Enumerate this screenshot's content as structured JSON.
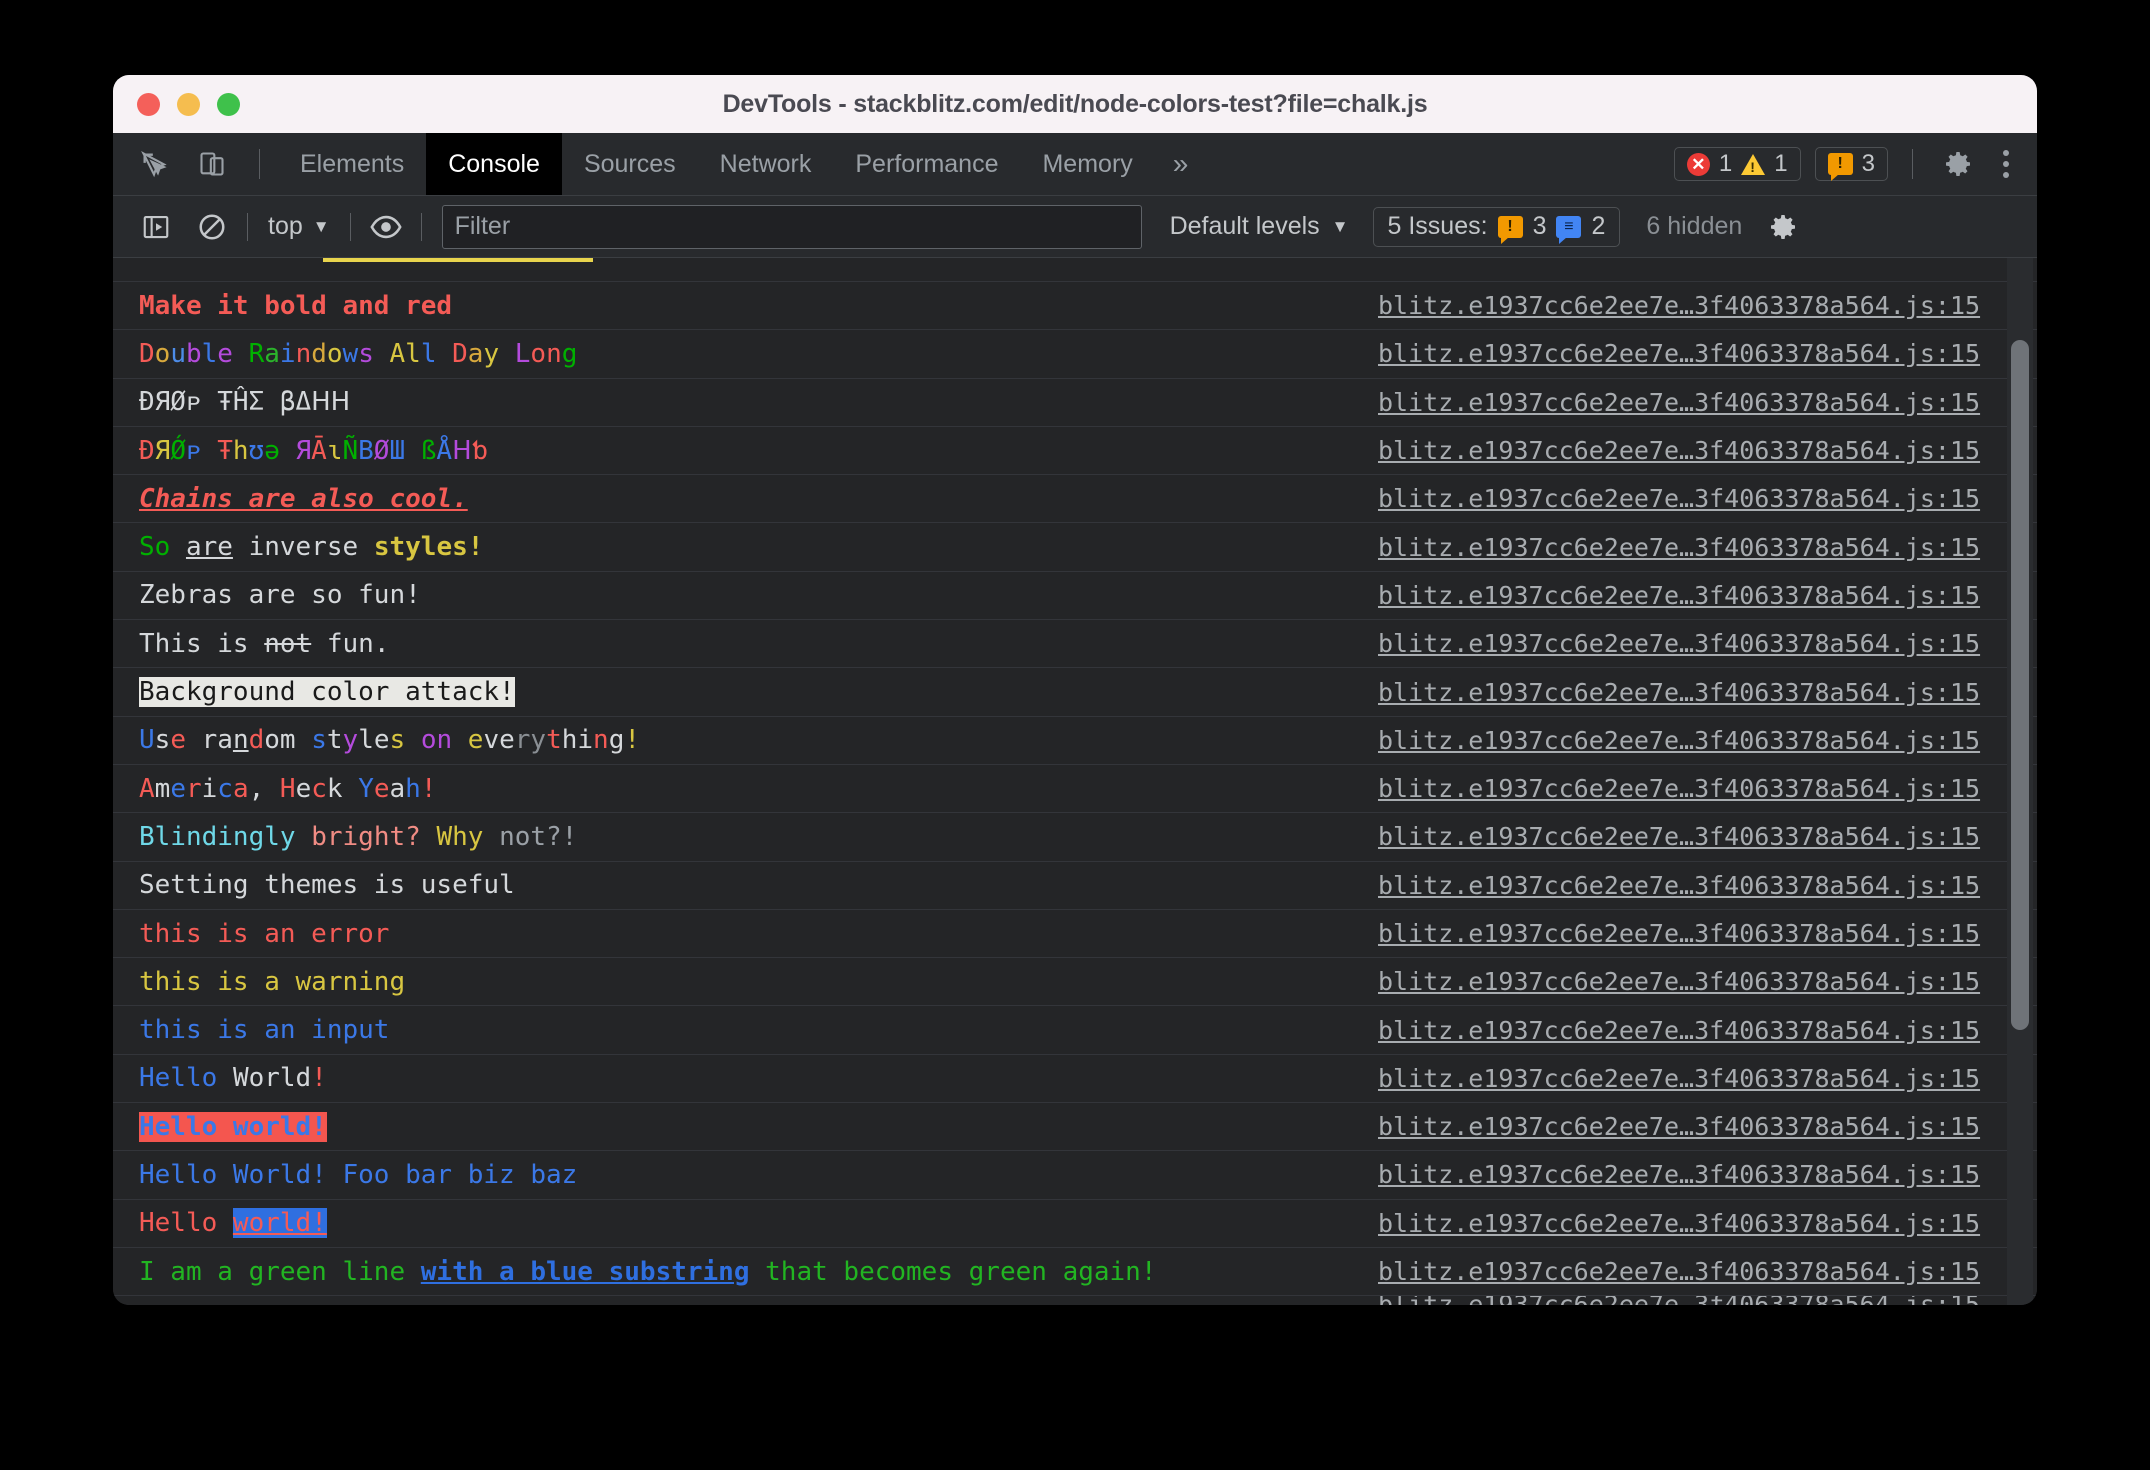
{
  "window": {
    "title": "DevTools - stackblitz.com/edit/node-colors-test?file=chalk.js",
    "traffic_lights": [
      "close",
      "minimize",
      "maximize"
    ]
  },
  "tabbar": {
    "inspect_icon": "inspect-element-icon",
    "device_icon": "device-toolbar-icon",
    "tabs": [
      {
        "label": "Elements",
        "active": false
      },
      {
        "label": "Console",
        "active": true
      },
      {
        "label": "Sources",
        "active": false
      },
      {
        "label": "Network",
        "active": false
      },
      {
        "label": "Performance",
        "active": false
      },
      {
        "label": "Memory",
        "active": false
      }
    ],
    "more_tabs_label": "»",
    "error_count": "1",
    "warning_count": "1",
    "issue_count": "3",
    "settings_icon": "gear-icon",
    "menu_icon": "kebab-menu-icon"
  },
  "console_toolbar": {
    "sidebar_icon": "console-sidebar-icon",
    "clear_icon": "clear-console-icon",
    "context": "top",
    "context_caret": "▼",
    "eye_icon": "live-expression-icon",
    "filter_placeholder": "Filter",
    "filter_value": "",
    "levels_label": "Default levels",
    "levels_caret": "▼",
    "issues_label": "5 Issues:",
    "issues_warning_count": "3",
    "issues_info_count": "2",
    "hidden_label": "6 hidden",
    "settings_icon": "console-settings-gear-icon"
  },
  "colors": {
    "red": "#f45b56",
    "bright_red": "#ff5f57",
    "green": "#00b000",
    "bright_green": "#3ec93e",
    "blue": "#3b78e7",
    "bright_blue": "#2f6fe0",
    "yellow": "#d8c641",
    "magenta": "#b44bdc",
    "cyan": "#6fd8e8",
    "white": "#d5d8db",
    "grey": "#9aa0a6",
    "bg_light": "#e8e8e4",
    "bg_dark": "#1a1a1a",
    "link": "#a8acb0"
  },
  "source_link": "blitz.e1937cc6e2ee7e…3f4063378a564.js:15",
  "messages": [
    {
      "id": "msg-partial-top",
      "partial": true,
      "segments": []
    },
    {
      "id": "msg-bold-red",
      "segments": [
        {
          "t": "Make it bold and red",
          "c": "#f45b56",
          "bold": true
        }
      ]
    },
    {
      "id": "msg-double-rainbow",
      "segments": [
        {
          "t": "D",
          "c": "#f45b56"
        },
        {
          "t": "o",
          "c": "#d8a93d"
        },
        {
          "t": "u",
          "c": "#4d8ce8"
        },
        {
          "t": "b",
          "c": "#b44bdc"
        },
        {
          "t": "l",
          "c": "#3b78e7"
        },
        {
          "t": "e",
          "c": "#b44bdc"
        },
        {
          "t": " ",
          "c": "#d5d8db"
        },
        {
          "t": "R",
          "c": "#00b000"
        },
        {
          "t": "a",
          "c": "#2bb32b"
        },
        {
          "t": "i",
          "c": "#3b78e7"
        },
        {
          "t": "n",
          "c": "#f45b56"
        },
        {
          "t": "d",
          "c": "#d8a93d"
        },
        {
          "t": "o",
          "c": "#d8c641"
        },
        {
          "t": "w",
          "c": "#3b78e7"
        },
        {
          "t": "s",
          "c": "#b44bdc"
        },
        {
          "t": " ",
          "c": "#d5d8db"
        },
        {
          "t": "A",
          "c": "#d8c641"
        },
        {
          "t": "l",
          "c": "#d8c641"
        },
        {
          "t": "l",
          "c": "#3b78e7"
        },
        {
          "t": " ",
          "c": "#d5d8db"
        },
        {
          "t": "D",
          "c": "#f45b56"
        },
        {
          "t": "a",
          "c": "#d8a93d"
        },
        {
          "t": "y",
          "c": "#d8c641"
        },
        {
          "t": " ",
          "c": "#d5d8db"
        },
        {
          "t": "L",
          "c": "#b44bdc"
        },
        {
          "t": "o",
          "c": "#f45b56"
        },
        {
          "t": "n",
          "c": "#f45b56"
        },
        {
          "t": "g",
          "c": "#00b000"
        }
      ]
    },
    {
      "id": "msg-drop-the-bass",
      "segments": [
        {
          "t": "ÐЯØᴘ ŦĤΣ βΔᕼᕼ",
          "c": "#d5d8db"
        }
      ]
    },
    {
      "id": "msg-drop-the-rainbow-bass",
      "segments": [
        {
          "t": "Ð",
          "c": "#f45b56"
        },
        {
          "t": "Я",
          "c": "#d8c641"
        },
        {
          "t": "Ǿ",
          "c": "#00b000"
        },
        {
          "t": "ᴘ",
          "c": "#3b78e7"
        },
        {
          "t": " ",
          "c": "#d5d8db"
        },
        {
          "t": "Ŧ",
          "c": "#f45b56"
        },
        {
          "t": "h",
          "c": "#d8c641"
        },
        {
          "t": "ʊ",
          "c": "#3b78e7"
        },
        {
          "t": "ə",
          "c": "#00b000"
        },
        {
          "t": " ",
          "c": "#d5d8db"
        },
        {
          "t": "Я",
          "c": "#b44bdc"
        },
        {
          "t": "Ā",
          "c": "#f45b56"
        },
        {
          "t": "ɩ",
          "c": "#d8c641"
        },
        {
          "t": "Ñ",
          "c": "#00b000"
        },
        {
          "t": "B",
          "c": "#3b78e7"
        },
        {
          "t": "Ø",
          "c": "#b44bdc"
        },
        {
          "t": "Ш",
          "c": "#3b78e7"
        },
        {
          "t": " ",
          "c": "#d5d8db"
        },
        {
          "t": "ß",
          "c": "#00b000"
        },
        {
          "t": "Å",
          "c": "#3b78e7"
        },
        {
          "t": "ᕼ",
          "c": "#b44bdc"
        },
        {
          "t": "ƅ",
          "c": "#f45b56"
        }
      ]
    },
    {
      "id": "msg-chains",
      "segments": [
        {
          "t": "Chains are also cool.",
          "c": "#f45b56",
          "bold": true,
          "italic": true,
          "underline": true
        }
      ]
    },
    {
      "id": "msg-inverse-styles",
      "segments": [
        {
          "t": "So",
          "c": "#00b000"
        },
        {
          "t": " ",
          "c": "#d5d8db"
        },
        {
          "t": "are",
          "c": "#d5d8db",
          "underline": true
        },
        {
          "t": " inverse ",
          "c": "#d5d8db"
        },
        {
          "t": "styles!",
          "c": "#d8c641",
          "bold": true
        }
      ]
    },
    {
      "id": "msg-zebras",
      "segments": [
        {
          "t": "Zebras are so fun!",
          "c": "#d5d8db"
        }
      ]
    },
    {
      "id": "msg-not-fun",
      "segments": [
        {
          "t": "This is ",
          "c": "#d5d8db"
        },
        {
          "t": "not",
          "c": "#d5d8db",
          "strike": true
        },
        {
          "t": " fun.",
          "c": "#d5d8db"
        }
      ]
    },
    {
      "id": "msg-background-attack",
      "segments": [
        {
          "t": "Background color attack!",
          "c": "#1a1a1a",
          "bg": "#e8e8e4"
        }
      ]
    },
    {
      "id": "msg-random-styles",
      "segments": [
        {
          "t": "U",
          "c": "#3b78e7"
        },
        {
          "t": "s",
          "c": "#d5d8db"
        },
        {
          "t": "e",
          "c": "#f45b56"
        },
        {
          "t": " ",
          "c": "#d5d8db"
        },
        {
          "t": "r",
          "c": "#d5d8db"
        },
        {
          "t": "a",
          "c": "#d5d8db"
        },
        {
          "t": "n",
          "c": "#d5d8db",
          "underline": true
        },
        {
          "t": "d",
          "c": "#f45b56"
        },
        {
          "t": "o",
          "c": "#d5d8db"
        },
        {
          "t": "m",
          "c": "#d5d8db"
        },
        {
          "t": " ",
          "c": "#d5d8db"
        },
        {
          "t": "s",
          "c": "#3b78e7"
        },
        {
          "t": "t",
          "c": "#d5d8db"
        },
        {
          "t": "y",
          "c": "#b44bdc"
        },
        {
          "t": "l",
          "c": "#d5d8db"
        },
        {
          "t": "e",
          "c": "#d5d8db"
        },
        {
          "t": "s",
          "c": "#d8c641"
        },
        {
          "t": " ",
          "c": "#d5d8db"
        },
        {
          "t": "o",
          "c": "#b44bdc"
        },
        {
          "t": "n",
          "c": "#b44bdc"
        },
        {
          "t": " ",
          "c": "#d5d8db"
        },
        {
          "t": "e",
          "c": "#d8c641"
        },
        {
          "t": "v",
          "c": "#d5d8db"
        },
        {
          "t": "e",
          "c": "#d5d8db"
        },
        {
          "t": "r",
          "c": "#8a8f94"
        },
        {
          "t": "y",
          "c": "#8a8f94"
        },
        {
          "t": "t",
          "c": "#f45b56"
        },
        {
          "t": "h",
          "c": "#d5d8db"
        },
        {
          "t": "i",
          "c": "#d5d8db"
        },
        {
          "t": "n",
          "c": "#f45b56"
        },
        {
          "t": "g",
          "c": "#d5d8db"
        },
        {
          "t": "!",
          "c": "#d8c641"
        }
      ]
    },
    {
      "id": "msg-america",
      "segments": [
        {
          "t": "A",
          "c": "#f45b56"
        },
        {
          "t": "m",
          "c": "#d5d8db"
        },
        {
          "t": "e",
          "c": "#3b78e7"
        },
        {
          "t": "r",
          "c": "#f45b56"
        },
        {
          "t": "i",
          "c": "#d5d8db"
        },
        {
          "t": "c",
          "c": "#3b78e7"
        },
        {
          "t": "a",
          "c": "#f45b56"
        },
        {
          "t": ", ",
          "c": "#d5d8db"
        },
        {
          "t": "H",
          "c": "#f45b56"
        },
        {
          "t": "e",
          "c": "#d5d8db"
        },
        {
          "t": "c",
          "c": "#f45b56"
        },
        {
          "t": "k",
          "c": "#d5d8db"
        },
        {
          "t": " ",
          "c": "#d5d8db"
        },
        {
          "t": "Y",
          "c": "#3b78e7"
        },
        {
          "t": "e",
          "c": "#f45b56"
        },
        {
          "t": "a",
          "c": "#d5d8db"
        },
        {
          "t": "h",
          "c": "#3b78e7"
        },
        {
          "t": "!",
          "c": "#f45b56"
        }
      ]
    },
    {
      "id": "msg-blindingly-bright",
      "segments": [
        {
          "t": "Blindingly",
          "c": "#6fd8e8"
        },
        {
          "t": " ",
          "c": "#d5d8db"
        },
        {
          "t": "bright?",
          "c": "#f08c84"
        },
        {
          "t": " ",
          "c": "#d5d8db"
        },
        {
          "t": "Why",
          "c": "#d8c641"
        },
        {
          "t": " ",
          "c": "#d5d8db"
        },
        {
          "t": "not?!",
          "c": "#9aa0a6"
        }
      ]
    },
    {
      "id": "msg-themes",
      "segments": [
        {
          "t": "Setting themes is useful",
          "c": "#d5d8db"
        }
      ]
    },
    {
      "id": "msg-error",
      "segments": [
        {
          "t": "this is an error",
          "c": "#f45b56"
        }
      ]
    },
    {
      "id": "msg-warning",
      "segments": [
        {
          "t": "this is a warning",
          "c": "#d8c641"
        }
      ]
    },
    {
      "id": "msg-input",
      "segments": [
        {
          "t": "this is an input",
          "c": "#3b78e7"
        }
      ]
    },
    {
      "id": "msg-hello-world-1",
      "segments": [
        {
          "t": "Hello",
          "c": "#3b78e7"
        },
        {
          "t": " ",
          "c": "#d5d8db"
        },
        {
          "t": "World",
          "c": "#d5d8db"
        },
        {
          "t": "!",
          "c": "#f45b56"
        }
      ]
    },
    {
      "id": "msg-hello-world-bg",
      "segments": [
        {
          "t": "Hello world!",
          "c": "#3b78e7",
          "bg": "#f4564f",
          "bold": true
        }
      ]
    },
    {
      "id": "msg-hello-world-foo",
      "segments": [
        {
          "t": "Hello World! Foo bar biz baz",
          "c": "#3b78e7"
        }
      ]
    },
    {
      "id": "msg-hello-world-underline",
      "segments": [
        {
          "t": "Hello ",
          "c": "#f45b56"
        },
        {
          "t": "world!",
          "c": "#f45b56",
          "bg": "#2f6fe0",
          "underline": true
        }
      ]
    },
    {
      "id": "msg-green-blue-substring",
      "segments": [
        {
          "t": "I am a green line ",
          "c": "#22b522"
        },
        {
          "t": "with a blue substring",
          "c": "#2f6fe0",
          "bold": true,
          "underline": true
        },
        {
          "t": " that becomes green again!",
          "c": "#22b522"
        }
      ]
    },
    {
      "id": "msg-partial-bottom",
      "partial": true,
      "segments": []
    }
  ]
}
